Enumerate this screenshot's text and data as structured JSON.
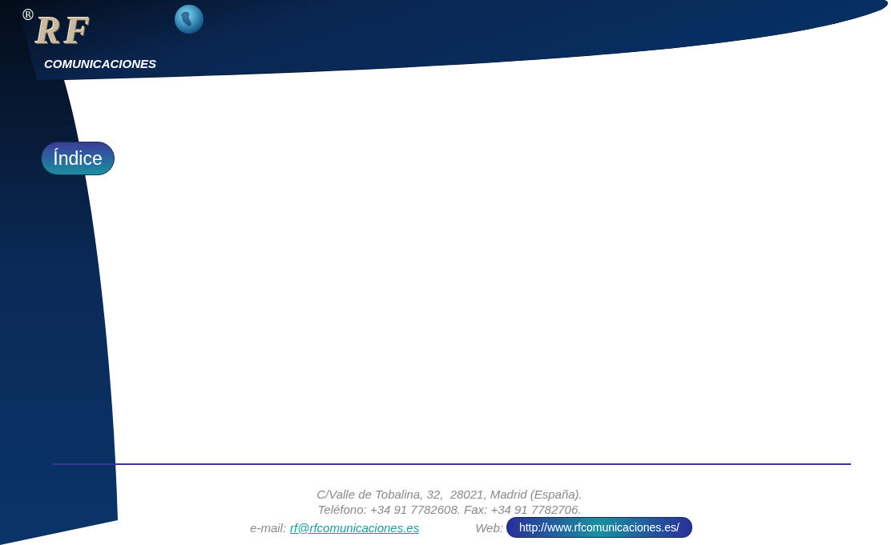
{
  "logo": {
    "registered": "®",
    "letters": "RF",
    "tagline": "COMUNICACIONES"
  },
  "index_button": {
    "label": "Índice"
  },
  "footer": {
    "address": "C/Valle de Tobalina, 32,  28021, Madrid (España).",
    "phone": "Teléfono: +34 91 7782608. Fax: +34 91 7782706.",
    "email_label": "e-mail:",
    "email": "rf@rfcomunicaciones.es",
    "web_label": "Web:",
    "web": "http://www.rfcomunicaciones.es/"
  }
}
